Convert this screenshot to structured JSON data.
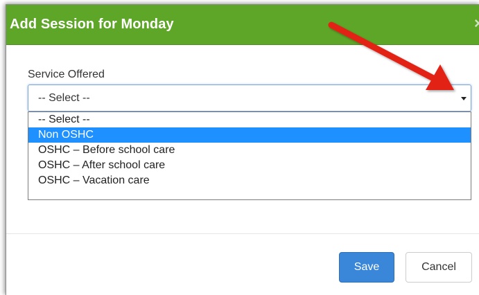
{
  "dialog": {
    "title": "Add Session for Monday",
    "close_glyph": "×"
  },
  "form": {
    "service_label": "Service Offered",
    "selected_value": "-- Select --",
    "options": [
      "-- Select --",
      "Non OSHC",
      "OSHC – Before school care",
      "OSHC – After school care",
      "OSHC – Vacation care"
    ],
    "highlighted_option": "Non OSHC"
  },
  "footer": {
    "save_label": "Save",
    "cancel_label": "Cancel"
  },
  "colors": {
    "header_green": "#5ea628",
    "save_blue": "#3a86d9",
    "highlight_blue": "#1e90ff",
    "annotation_arrow": "#e32119"
  },
  "icons": {
    "close": "close-icon",
    "caret": "caret-down-icon",
    "annotation": "red-arrow-annotation"
  }
}
